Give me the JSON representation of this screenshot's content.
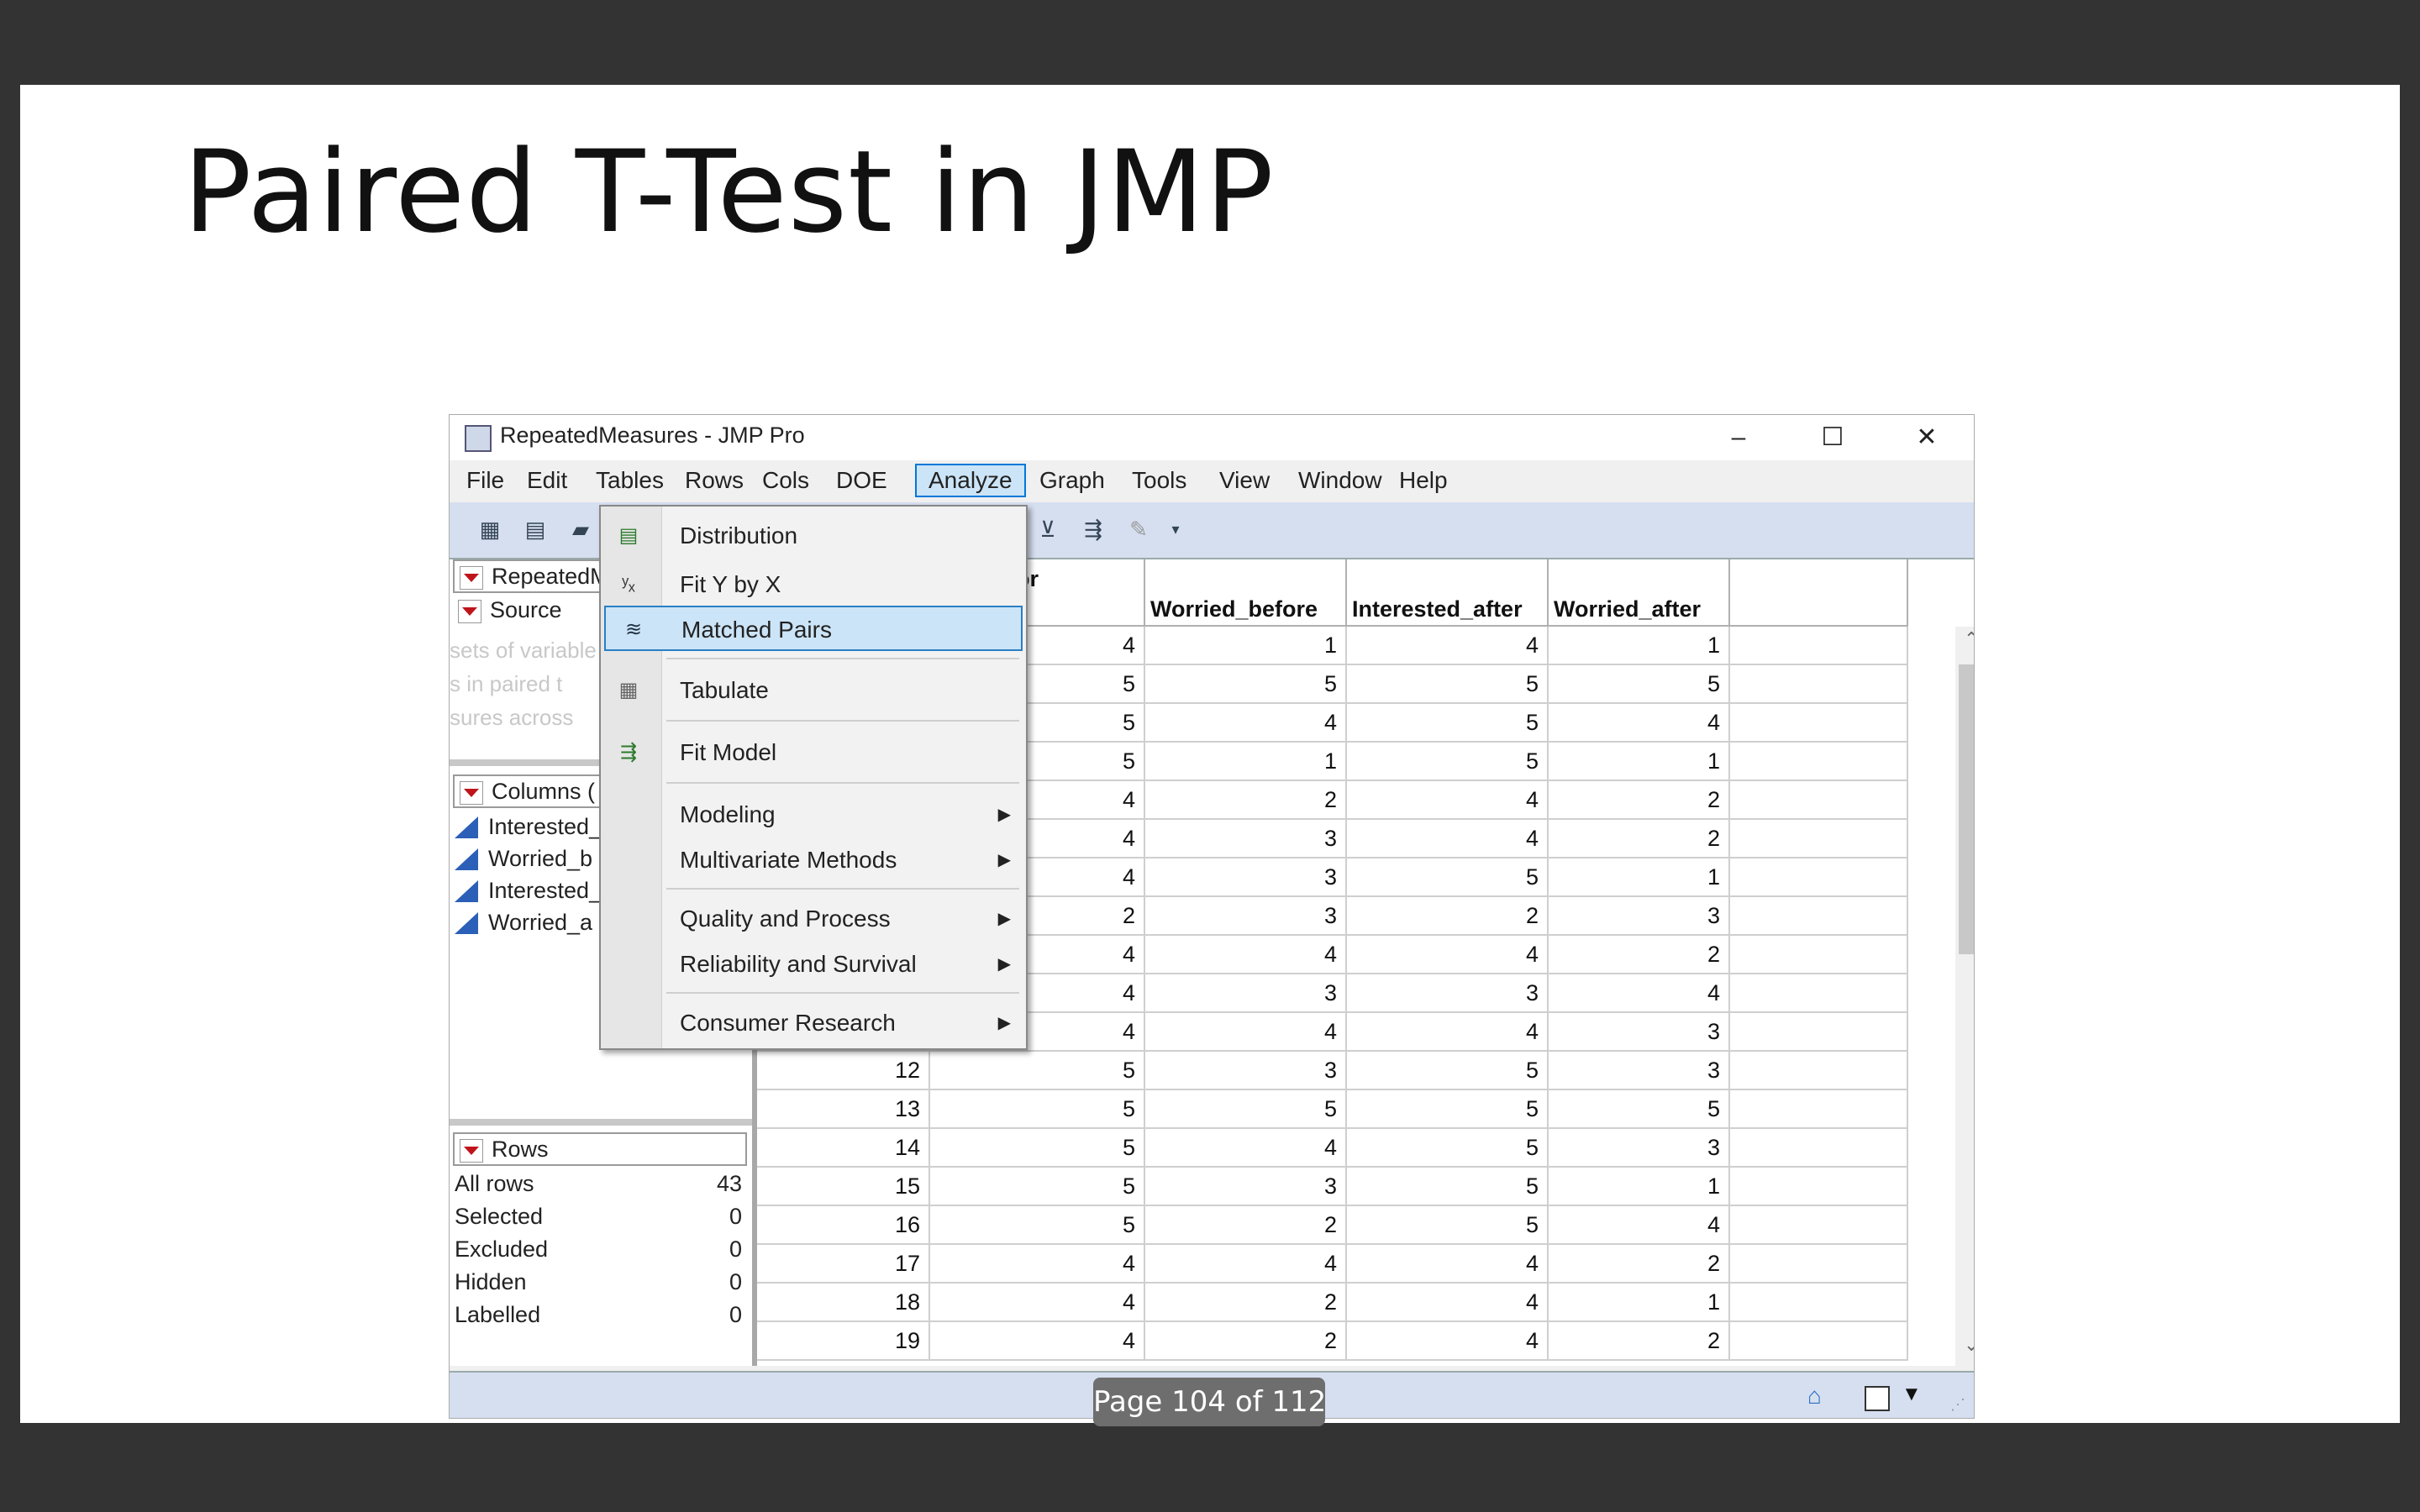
{
  "slide": {
    "title": "Paired T-Test in JMP"
  },
  "window": {
    "title": "RepeatedMeasures - JMP Pro",
    "controls": {
      "minimize": "–",
      "maximize": "☐",
      "close": "✕"
    }
  },
  "menubar": [
    "File",
    "Edit",
    "Tables",
    "Rows",
    "Cols",
    "DOE",
    "Analyze",
    "Graph",
    "Tools",
    "View",
    "Window",
    "Help"
  ],
  "analyze_menu": {
    "items": [
      {
        "label": "Distribution",
        "icon": "distribution-icon"
      },
      {
        "label": "Fit Y by X",
        "icon": "fit-y-by-x-icon"
      },
      {
        "label": "Matched Pairs",
        "icon": "matched-pairs-icon",
        "highlighted": true
      },
      {
        "label": "Tabulate",
        "icon": "tabulate-icon"
      },
      {
        "label": "Fit Model",
        "icon": "fit-model-icon"
      },
      {
        "label": "Modeling",
        "submenu": true
      },
      {
        "label": "Multivariate Methods",
        "submenu": true
      },
      {
        "label": "Quality and Process",
        "submenu": true
      },
      {
        "label": "Reliability and Survival",
        "submenu": true
      },
      {
        "label": "Consumer Research",
        "submenu": true
      }
    ]
  },
  "left_panel": {
    "table_header": "RepeatedM",
    "source_label": "Source",
    "notes": [
      "sets of variable",
      "s in paired t",
      "sures across"
    ],
    "columns_header": "Columns (",
    "columns": [
      "Interested_",
      "Worried_b",
      "Interested_",
      "Worried_a"
    ],
    "rows_header": "Rows",
    "row_stats": [
      {
        "label": "All rows",
        "value": "43"
      },
      {
        "label": "Selected",
        "value": "0"
      },
      {
        "label": "Excluded",
        "value": "0"
      },
      {
        "label": "Hidden",
        "value": "0"
      },
      {
        "label": "Labelled",
        "value": "0"
      }
    ]
  },
  "table": {
    "headers": [
      "",
      "ted_befor e",
      "Worried_before",
      "Interested_after",
      "Worried_after",
      ""
    ],
    "rows": [
      [
        "",
        "4",
        "1",
        "4",
        "1"
      ],
      [
        "",
        "5",
        "5",
        "5",
        "5"
      ],
      [
        "",
        "5",
        "4",
        "5",
        "4"
      ],
      [
        "",
        "5",
        "1",
        "5",
        "1"
      ],
      [
        "",
        "4",
        "2",
        "4",
        "2"
      ],
      [
        "",
        "4",
        "3",
        "4",
        "2"
      ],
      [
        "",
        "4",
        "3",
        "5",
        "1"
      ],
      [
        "",
        "2",
        "3",
        "2",
        "3"
      ],
      [
        "",
        "4",
        "4",
        "4",
        "2"
      ],
      [
        "",
        "4",
        "3",
        "3",
        "4"
      ],
      [
        "",
        "4",
        "4",
        "4",
        "3"
      ],
      [
        "12",
        "5",
        "3",
        "5",
        "3"
      ],
      [
        "13",
        "5",
        "5",
        "5",
        "5"
      ],
      [
        "14",
        "5",
        "4",
        "5",
        "3"
      ],
      [
        "15",
        "5",
        "3",
        "5",
        "1"
      ],
      [
        "16",
        "5",
        "2",
        "5",
        "4"
      ],
      [
        "17",
        "4",
        "4",
        "4",
        "2"
      ],
      [
        "18",
        "4",
        "2",
        "4",
        "1"
      ],
      [
        "19",
        "4",
        "2",
        "4",
        "2"
      ]
    ]
  },
  "page_indicator": "Page 104 of 112",
  "colors": {
    "accent": "#0078d7",
    "highlight": "#cce4f7",
    "toolbar": "#d6dff0",
    "triangle": "#c0141b",
    "column_icon": "#2b5fb8"
  }
}
